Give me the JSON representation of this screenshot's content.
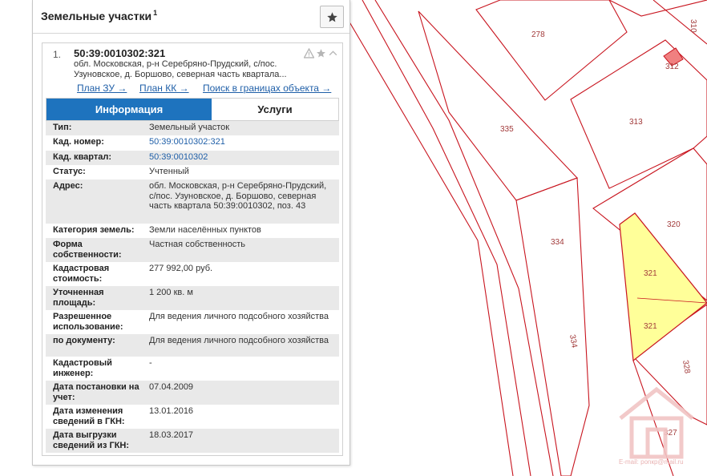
{
  "panel": {
    "title": "Земельные участки",
    "count": "1",
    "favorite_icon": "star-icon"
  },
  "item": {
    "number": "1.",
    "cad_number": "50:39:0010302:321",
    "address_short": "обл. Московская, р-н Серебряно-Прудский, с/пос. Узуновское, д. Боршово, северная часть квартала...",
    "tool_icons": [
      "warning-icon",
      "star-icon",
      "chevron-up-icon"
    ],
    "links": [
      {
        "label": "План ЗУ →"
      },
      {
        "label": "План КК →"
      },
      {
        "label": "Поиск в границах объекта →"
      }
    ]
  },
  "tabs": [
    {
      "label": "Информация",
      "active": true
    },
    {
      "label": "Услуги",
      "active": false
    }
  ],
  "properties": [
    {
      "key": "Тип:",
      "value": "Земельный участок",
      "link": false
    },
    {
      "key": "Кад. номер:",
      "value": "50:39:0010302:321",
      "link": true
    },
    {
      "key": "Кад. квартал:",
      "value": "50:39:0010302",
      "link": true
    },
    {
      "key": "Статус:",
      "value": "Учтенный",
      "link": false
    },
    {
      "key": "Адрес:",
      "value": "обл. Московская, р-н Серебряно-Прудский, с/пос. Узуновское, д. Боршово, северная часть квартала 50:39:0010302, поз. 43",
      "link": false
    },
    {
      "key": "Категория земель:",
      "value": "Земли населённых пунктов",
      "link": false
    },
    {
      "key": "Форма собственности:",
      "value": "Частная собственность",
      "link": false
    },
    {
      "key": "Кадастровая стоимость:",
      "value": "277 992,00 руб.",
      "link": false
    },
    {
      "key": "Уточненная площадь:",
      "value": "1 200 кв. м",
      "link": false
    },
    {
      "key": "Разрешенное использование:",
      "value": "Для ведения личного подсобного хозяйства",
      "link": false
    },
    {
      "key": "по документу:",
      "value": "Для ведения личного подсобного хозяйства",
      "link": false
    },
    {
      "key": "Кадастровый инженер:",
      "value": "-",
      "link": false
    },
    {
      "key": "Дата постановки на учет:",
      "value": "07.04.2009",
      "link": false
    },
    {
      "key": "Дата изменения сведений в ГКН:",
      "value": "13.01.2016",
      "link": false
    },
    {
      "key": "Дата выгрузки сведений из ГКН:",
      "value": "18.03.2017",
      "link": false
    }
  ],
  "map": {
    "plot_labels": [
      "278",
      "310",
      "312",
      "313",
      "335",
      "320",
      "334",
      "321",
      "321",
      "334",
      "328",
      "327"
    ],
    "selected_fill": "#ffff99",
    "boundary_color": "#c8141e"
  },
  "watermark": {
    "text": "E-mail: ponкр@mail.ru"
  }
}
